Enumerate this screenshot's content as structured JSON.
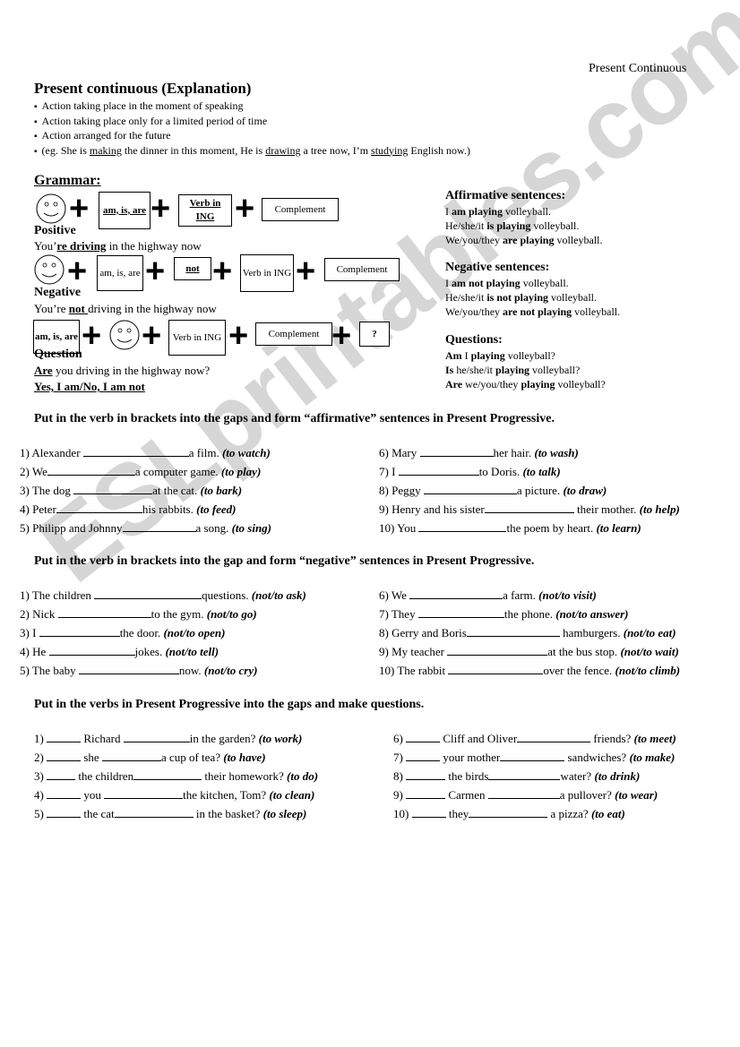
{
  "watermark": "ESLprintables.com",
  "header": {
    "right_title": "Present Continuous"
  },
  "explanation": {
    "title": "Present continuous (Explanation)",
    "bullets": [
      "Action taking place in the moment of speaking",
      "Action taking place only for a limited period of time",
      "Action arranged for the future"
    ],
    "example": {
      "prefix": "(eg. She is ",
      "w1": "making",
      "mid1": " the dinner in this moment, He is ",
      "w2": "drawing",
      "mid2": " a tree now, I’m ",
      "w3": "studying",
      "suffix": " English now.)"
    }
  },
  "grammar": {
    "title": "Grammar:",
    "positive": {
      "boxes": [
        "am, is, are",
        "Verb in ING",
        "Complement"
      ],
      "label": "Positive",
      "example_pre": "You’",
      "example_bold": "re driving",
      "example_post": " in the highway now"
    },
    "negative": {
      "boxes": [
        "am, is, are",
        "not",
        "Verb in ING",
        "Complement"
      ],
      "label": "Negative",
      "example_pre": "You’re ",
      "example_bold": "not ",
      "example_post": "driving in the highway now"
    },
    "question": {
      "boxes": [
        "am, is, are",
        "Verb in ING",
        "Complement",
        "?"
      ],
      "label": "Question",
      "example_bold": "Are",
      "example_post": " you driving in the highway now?",
      "answer": "Yes, I am/No, I am not"
    }
  },
  "rules": {
    "affirmative": {
      "title": "Affirmative sentences:",
      "lines": [
        {
          "pre": "I ",
          "bold": "am playing",
          "post": " volleyball."
        },
        {
          "pre": "He/she/it ",
          "bold": "is playing",
          "post": " volleyball."
        },
        {
          "pre": "We/you/they ",
          "bold": "are playing",
          "post": " volleyball."
        }
      ]
    },
    "negative": {
      "title": "Negative sentences:",
      "lines": [
        {
          "pre": "I ",
          "bold": "am not playing",
          "post": " volleyball."
        },
        {
          "pre": "He/she/it ",
          "bold": "is not playing",
          "post": " volleyball."
        },
        {
          "pre": "We/you/they ",
          "bold": "are not playing",
          "post": " volleyball."
        }
      ]
    },
    "questions": {
      "title": "Questions:",
      "lines": [
        {
          "b1": "Am",
          "m": " I ",
          "b2": "playing",
          "post": " volleyball?"
        },
        {
          "b1": "Is",
          "m": " he/she/it ",
          "b2": "playing",
          "post": " volleyball?"
        },
        {
          "b1": "Are",
          "m": " we/you/they ",
          "b2": "playing",
          "post": " volleyball?"
        }
      ]
    }
  },
  "exercises": [
    {
      "instruction": "Put in the verb in brackets into the gaps and form “affirmative” sentences in Present Progressive.",
      "items": [
        {
          "n": "1)",
          "pre": "Alexander ",
          "post": "a film. ",
          "hint": "(to watch)"
        },
        {
          "n": "2)",
          "pre": "We",
          "post": "a computer game. ",
          "hint": "(to play)"
        },
        {
          "n": "3)",
          "pre": "The dog ",
          "post": "at the cat. ",
          "hint": "(to bark)"
        },
        {
          "n": "4)",
          "pre": "Peter",
          "post": "his rabbits. ",
          "hint": "(to feed)"
        },
        {
          "n": "5)",
          "pre": "Philipp and Johnny",
          "post": "a song. ",
          "hint": "(to sing)"
        },
        {
          "n": "6)",
          "pre": "Mary ",
          "post": "her hair. ",
          "hint": "(to wash)"
        },
        {
          "n": "7)",
          "pre": "I ",
          "post": "to Doris. ",
          "hint": "(to talk)"
        },
        {
          "n": "8)",
          "pre": "Peggy ",
          "post": "a picture. ",
          "hint": "(to draw)"
        },
        {
          "n": "9)",
          "pre": "Henry and his sister",
          "post": " their mother. ",
          "hint": "(to help)"
        },
        {
          "n": "10)",
          "pre": "You ",
          "post": "the poem by heart. ",
          "hint": "(to learn)"
        }
      ]
    },
    {
      "instruction": "Put in the verb in brackets into the gap and form “negative” sentences in Present Progressive.",
      "items": [
        {
          "n": "1)",
          "pre": "The children ",
          "post": "questions. ",
          "hint": "(not/to ask)"
        },
        {
          "n": "2)",
          "pre": "Nick ",
          "post": "to the gym. ",
          "hint": "(not/to go)"
        },
        {
          "n": "3)",
          "pre": "I ",
          "post": "the door. ",
          "hint": "(not/to open)"
        },
        {
          "n": "4)",
          "pre": "He ",
          "post": "jokes. ",
          "hint": "(not/to tell)"
        },
        {
          "n": "5)",
          "pre": "The baby ",
          "post": "now. ",
          "hint": "(not/to cry)"
        },
        {
          "n": "6)",
          "pre": "We ",
          "post": "a farm. ",
          "hint": "(not/to visit)"
        },
        {
          "n": "7)",
          "pre": "They ",
          "post": "the phone. ",
          "hint": "(not/to answer)"
        },
        {
          "n": "8)",
          "pre": "Gerry and Boris",
          "post": " hamburgers. ",
          "hint": "(not/to eat)"
        },
        {
          "n": "9)",
          "pre": "My teacher ",
          "post": "at the bus stop. ",
          "hint": "(not/to wait)"
        },
        {
          "n": "10)",
          "pre": "The rabbit ",
          "post": "over the fence. ",
          "hint": "(not/to climb)"
        }
      ]
    },
    {
      "instruction": "Put in the verbs in Present Progressive into the gaps and make questions.",
      "items": [
        {
          "n": "1)",
          "mid": " Richard ",
          "post": "in the garden? ",
          "hint": "(to work)"
        },
        {
          "n": "2)",
          "mid": " she ",
          "post": "a cup of tea? ",
          "hint": "(to have)"
        },
        {
          "n": "3)",
          "mid": " the children",
          "post": " their homework? ",
          "hint": "(to do)"
        },
        {
          "n": "4)",
          "mid": " you ",
          "post": "the kitchen, Tom? ",
          "hint": "(to clean)"
        },
        {
          "n": "5)",
          "mid": " the cat",
          "post": " in the basket? ",
          "hint": "(to sleep)"
        },
        {
          "n": "6)",
          "mid": " Cliff and Oliver",
          "post": " friends? ",
          "hint": "(to meet)"
        },
        {
          "n": "7)",
          "mid": " your mother",
          "post": " sandwiches? ",
          "hint": "(to make)"
        },
        {
          "n": "8)",
          "mid": " the birds",
          "post": "water? ",
          "hint": "(to drink)"
        },
        {
          "n": "9)",
          "mid": " Carmen ",
          "post": "a pullover? ",
          "hint": "(to wear)"
        },
        {
          "n": "10)",
          "mid": " they",
          "post": " a pizza? ",
          "hint": "(to eat)"
        }
      ]
    }
  ]
}
